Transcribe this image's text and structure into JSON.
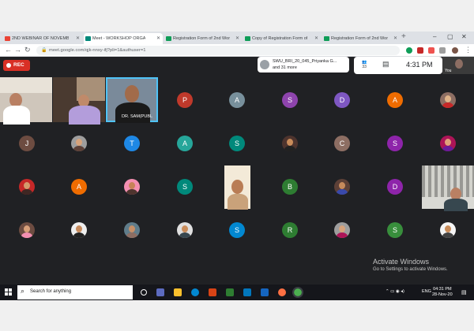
{
  "browser": {
    "tabs": [
      {
        "label": "2ND WEBINAR OF NOVEMBE",
        "color": "#ea4335",
        "active": false
      },
      {
        "label": "Meet - WORKSHOP ORGA",
        "color": "#00897b",
        "active": true
      },
      {
        "label": "Registration Form of 2nd Wor",
        "color": "#0f9d58",
        "active": false
      },
      {
        "label": "Copy of Registration Form of",
        "color": "#0f9d58",
        "active": false
      },
      {
        "label": "Registration Form of 2nd Wor",
        "color": "#0f9d58",
        "active": false
      }
    ],
    "new_tab": "+",
    "url": "meet.google.com/qjk-nnxy-ifj?pli=1&authuser=1"
  },
  "meet": {
    "rec_label": "REC",
    "presenter_name": "SWU_BRI_20_045_Priyanka G...",
    "presenter_more": "and 31 more",
    "time": "4:31 PM",
    "self_label": "You",
    "tiles_row1": [
      {
        "type": "letter",
        "letter": "P",
        "color": "#c0392b"
      },
      {
        "type": "letter",
        "letter": "A",
        "color": "#78909c"
      },
      {
        "type": "letter",
        "letter": "S",
        "color": "#8e44ad"
      },
      {
        "type": "letter",
        "letter": "D",
        "color": "#7e57c2"
      },
      {
        "type": "letter",
        "letter": "A",
        "color": "#ef6c00"
      },
      {
        "type": "photo",
        "bg": "#8d6e63",
        "face": "#e0b48a",
        "body": "#c62828"
      }
    ],
    "tiles_row2": [
      {
        "type": "letter",
        "letter": "J",
        "color": "#6d4c41"
      },
      {
        "type": "photo",
        "bg": "#9e9e9e",
        "face": "#d7a37b",
        "body": "#5d4037"
      },
      {
        "type": "letter",
        "letter": "T",
        "color": "#1e88e5"
      },
      {
        "type": "letter",
        "letter": "A",
        "color": "#26a69a"
      },
      {
        "type": "letter",
        "letter": "S",
        "color": "#00897b"
      },
      {
        "type": "photo",
        "bg": "#4e342e",
        "face": "#c98c5a",
        "body": "#212121"
      },
      {
        "type": "letter",
        "letter": "C",
        "color": "#8d6e63"
      },
      {
        "type": "letter",
        "letter": "S",
        "color": "#8e24aa"
      },
      {
        "type": "photo",
        "bg": "#ad1457",
        "face": "#e0a17a",
        "body": "#6a1b9a"
      }
    ],
    "tiles_row3": [
      {
        "type": "photo",
        "bg": "#c62828",
        "face": "#d59a6c",
        "body": "#3e2723"
      },
      {
        "type": "letter",
        "letter": "A",
        "color": "#ef6c00"
      },
      {
        "type": "photo",
        "bg": "#f48fb1",
        "face": "#c78258",
        "body": "#4e342e"
      },
      {
        "type": "letter",
        "letter": "S",
        "color": "#00897b"
      },
      {
        "type": "letter",
        "letter": "B",
        "color": "#2e7d32"
      },
      {
        "type": "photo",
        "bg": "#5d4037",
        "face": "#c68a5c",
        "body": "#3949ab"
      },
      {
        "type": "letter",
        "letter": "D",
        "color": "#8e24aa"
      }
    ],
    "tiles_row4": [
      {
        "type": "photo",
        "bg": "#6d4c41",
        "face": "#d9a07a",
        "body": "#f48fb1"
      },
      {
        "type": "photo",
        "bg": "#eeeeee",
        "face": "#c68a5c",
        "body": "#212121"
      },
      {
        "type": "photo",
        "bg": "#607d8b",
        "face": "#c79068",
        "body": "#8d6e63"
      },
      {
        "type": "photo",
        "bg": "#e0e0e0",
        "face": "#c98c5a",
        "body": "#37474f"
      },
      {
        "type": "letter",
        "letter": "S",
        "color": "#0288d1"
      },
      {
        "type": "letter",
        "letter": "R",
        "color": "#2e7d32"
      },
      {
        "type": "photo",
        "bg": "#9e9e9e",
        "face": "#d7a37b",
        "body": "#ad1457"
      },
      {
        "type": "letter",
        "letter": "S",
        "color": "#388e3c"
      },
      {
        "type": "photo",
        "bg": "#f5f5f5",
        "face": "#c98c5a",
        "body": "#424242"
      }
    ],
    "video_caption": "DR. SAM(PUBL"
  },
  "watermark": {
    "line1": "Activate Windows",
    "line2": "Go to Settings to activate Windows."
  },
  "taskbar": {
    "search_placeholder": "Search for anything",
    "lang": "ENG",
    "clock_time": "04:31 PM",
    "clock_date": "28-Nov-20"
  }
}
